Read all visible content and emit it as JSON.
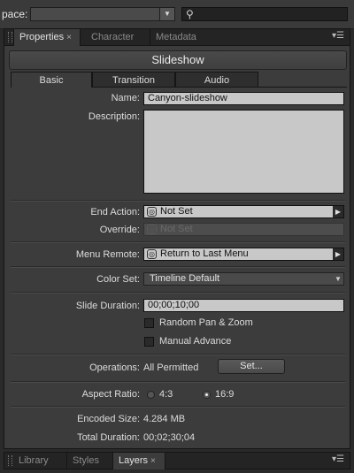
{
  "workspace": {
    "label": "pace:",
    "selected": ""
  },
  "search": {
    "placeholder": ""
  },
  "top_tabs": [
    {
      "label": "Properties"
    },
    {
      "label": "Character"
    },
    {
      "label": "Metadata"
    }
  ],
  "panel": {
    "title": "Slideshow",
    "subtabs": [
      "Basic",
      "Transition",
      "Audio"
    ]
  },
  "form": {
    "name_label": "Name:",
    "name_value": "Canyon-slideshow",
    "description_label": "Description:",
    "end_action_label": "End Action:",
    "end_action_value": "Not Set",
    "override_label": "Override:",
    "override_value": "Not Set",
    "menu_remote_label": "Menu Remote:",
    "menu_remote_value": "Return to Last Menu",
    "color_set_label": "Color Set:",
    "color_set_value": "Timeline Default",
    "slide_duration_label": "Slide Duration:",
    "slide_duration_value": "00;00;10;00",
    "random_pan_zoom": "Random Pan & Zoom",
    "manual_advance": "Manual Advance",
    "operations_label": "Operations:",
    "operations_value": "All Permitted",
    "set_button": "Set...",
    "aspect_ratio_label": "Aspect Ratio:",
    "aspect_4_3": "4:3",
    "aspect_16_9": "16:9",
    "encoded_size_label": "Encoded Size:",
    "encoded_size_value": "4.284 MB",
    "total_duration_label": "Total Duration:",
    "total_duration_value": "00;02;30;04"
  },
  "bottom_tabs": [
    {
      "label": "Library"
    },
    {
      "label": "Styles"
    },
    {
      "label": "Layers"
    }
  ],
  "icons": {
    "search": "search-icon",
    "dropdown": "chevron-down-icon",
    "play": "play-arrow-icon",
    "panel_menu": "panel-menu-icon",
    "close": "close-icon"
  }
}
